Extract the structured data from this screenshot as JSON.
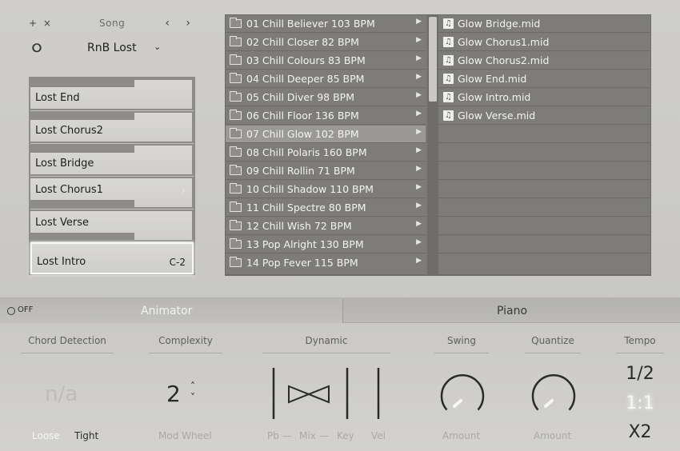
{
  "song": {
    "controls": "+ ×",
    "title": "Song",
    "nav": "‹ ›",
    "link_icon": "link-icon",
    "name": "RnB Lost",
    "dropdown": "⌄"
  },
  "sections": [
    {
      "label": "Lost End",
      "key": ""
    },
    {
      "label": "Lost Chorus2",
      "key": ""
    },
    {
      "label": "Lost Bridge",
      "key": ""
    },
    {
      "label": "Lost Chorus1",
      "key": ""
    },
    {
      "label": "Lost Verse",
      "key": ""
    },
    {
      "label": "Lost Intro",
      "key": "C-2"
    }
  ],
  "browser": {
    "folders": [
      "01 Chill Believer 103 BPM",
      "02 Chill Closer 82 BPM",
      "03 Chill Colours 83 BPM",
      "04 Chill Deeper 85 BPM",
      "05 Chill Diver 98 BPM",
      "06 Chill Floor 136 BPM",
      "07 Chill Glow 102 BPM",
      "08 Chill Polaris 160 BPM",
      "09 Chill Rollin 71 BPM",
      "10 Chill Shadow 110 BPM",
      "11 Chill Spectre 80 BPM",
      "12 Chill Wish 72 BPM",
      "13 Pop Alright 130 BPM",
      "14 Pop Fever 115 BPM"
    ],
    "selected_folder": "07 Chill Glow 102 BPM",
    "files": [
      "Glow Bridge.mid",
      "Glow Chorus1.mid",
      "Glow Chorus2.mid",
      "Glow End.mid",
      "Glow Intro.mid",
      "Glow Verse.mid"
    ]
  },
  "tabs": {
    "power_label": "OFF",
    "animator": "Animator",
    "piano": "Piano"
  },
  "controls": {
    "chord_detection": {
      "title": "Chord Detection",
      "value": "n/a",
      "loose": "Loose",
      "tight": "Tight"
    },
    "complexity": {
      "title": "Complexity",
      "value": "2",
      "sub": "Mod Wheel"
    },
    "dynamic": {
      "title": "Dynamic",
      "pb": "Pb",
      "mix": "Mix",
      "key": "Key",
      "vel": "Vel"
    },
    "swing": {
      "title": "Swing",
      "sub": "Amount"
    },
    "quantize": {
      "title": "Quantize",
      "sub": "Amount"
    },
    "tempo": {
      "title": "Tempo",
      "options": [
        "1/2",
        "1:1",
        "X2"
      ],
      "selected": "1:1"
    }
  }
}
